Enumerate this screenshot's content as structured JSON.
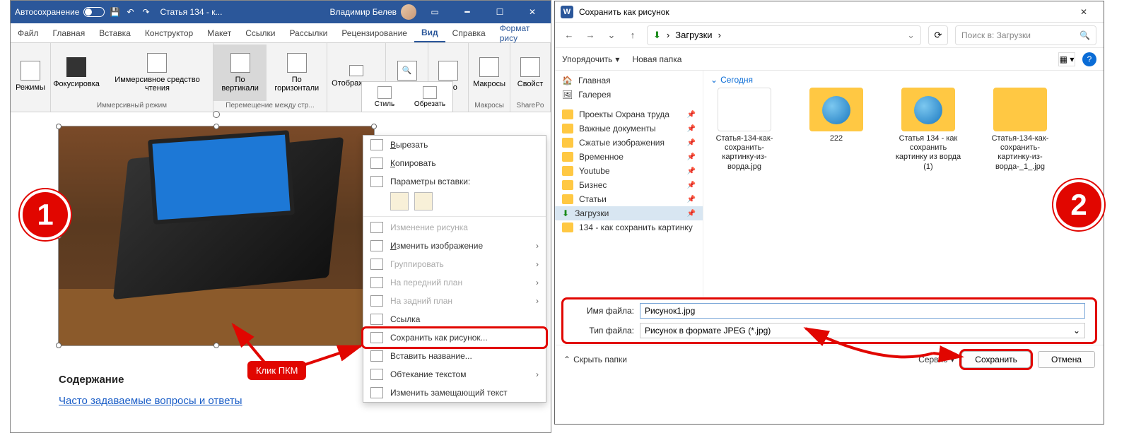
{
  "word": {
    "titlebar": {
      "autosave": "Автосохранение",
      "doc": "Статья 134 - к...",
      "user": "Владимир Белев"
    },
    "tabs": [
      "Файл",
      "Главная",
      "Вставка",
      "Конструктор",
      "Макет",
      "Ссылки",
      "Рассылки",
      "Рецензирование",
      "Вид",
      "Справка",
      "Формат рису"
    ],
    "active_tab": "Вид",
    "ribbon": {
      "g1": {
        "items": [
          "Режимы"
        ],
        "label": ""
      },
      "g2": {
        "items": [
          "Фокусировка",
          "Иммерсивное средство чтения"
        ],
        "label": "Иммерсивный режим"
      },
      "g3": {
        "items": [
          "По вертикали",
          "По горизонтали"
        ],
        "label": "Перемещение между стр..."
      },
      "g4": {
        "items": [
          "Отображение"
        ],
        "label": ""
      },
      "g5": {
        "items": [
          "Масштаб"
        ],
        "label": ""
      },
      "g6": {
        "items": [
          "Окно"
        ],
        "label": ""
      },
      "g7": {
        "items": [
          "Макросы"
        ],
        "label": "Макросы"
      },
      "g8": {
        "items": [
          "Свойст"
        ],
        "label": "SharePo"
      }
    },
    "floatbar": [
      "Стиль",
      "Обрезать"
    ],
    "context": {
      "cut": "Вырезать",
      "copy": "Копировать",
      "paste_title": "Параметры вставки:",
      "edit_pic": "Изменение рисунка",
      "change_img": "Изменить изображение",
      "group": "Группировать",
      "front": "На передний план",
      "back": "На задний план",
      "link": "Ссылка",
      "save_as": "Сохранить как рисунок...",
      "insert_caption": "Вставить название...",
      "wrap": "Обтекание текстом",
      "replace": "Изменить замещающий текст"
    },
    "content": {
      "heading": "Содержание",
      "link": "Часто задаваемые вопросы и ответы"
    },
    "annot": {
      "tag": "Клик ПКМ",
      "badge": "1"
    }
  },
  "dialog": {
    "title": "Сохранить как рисунок",
    "crumb_root": "Загрузки",
    "search_ph": "Поиск в: Загрузки",
    "toolbar": {
      "org": "Упорядочить",
      "newf": "Новая папка"
    },
    "side": {
      "home": "Главная",
      "gallery": "Галерея",
      "pins": [
        "Проекты Охрана труда",
        "Важные документы",
        "Сжатые изображения",
        "Временное",
        "Youtube",
        "Бизнес",
        "Статьи",
        "Загрузки",
        "134 - как сохранить картинку"
      ]
    },
    "group": "Сегодня",
    "files": [
      {
        "name": "Статья-134-как-сохранить-картинку-из-ворда.jpg",
        "type": "doc"
      },
      {
        "name": "222",
        "type": "folder"
      },
      {
        "name": "Статья 134 - как сохранить картинку из ворда (1)",
        "type": "folder"
      },
      {
        "name": "Статья-134-как-сохранить-картинку-из-ворда-_1_.jpg",
        "type": "folder"
      }
    ],
    "form": {
      "name_label": "Имя файла:",
      "name_value": "Рисунок1.jpg",
      "type_label": "Тип файла:",
      "type_value": "Рисунок в формате JPEG (*.jpg)"
    },
    "footer": {
      "hide": "Скрыть папки",
      "tools": "Сервис",
      "save": "Сохранить",
      "cancel": "Отмена"
    },
    "badge": "2"
  }
}
